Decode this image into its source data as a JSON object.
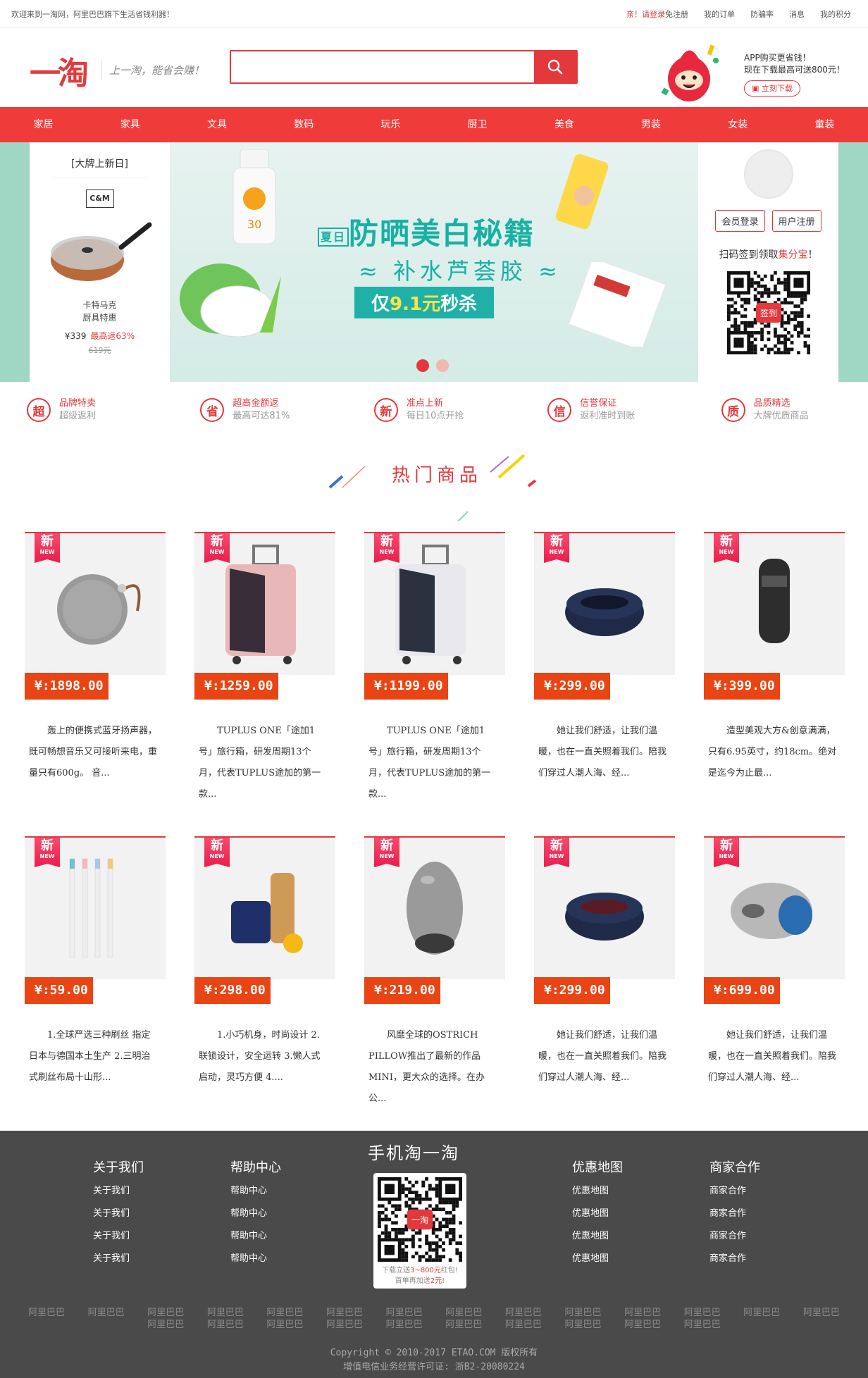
{
  "topbar": {
    "welcome": "欢迎来到一淘网，阿里巴巴旗下生活省钱利器！",
    "login_prefix": "亲！请登录",
    "register": "免注册",
    "links": [
      "我的订单",
      "防骗率",
      "消息",
      "我的积分"
    ]
  },
  "header": {
    "logo": "一淘",
    "slogan": "上一淘，能省会赚！",
    "search_placeholder": "",
    "app_promo_line1": "APP购买更省钱！",
    "app_promo_line2": "现在下载最高可送800元！",
    "download": "立刻下载"
  },
  "nav": [
    "家居",
    "家具",
    "文具",
    "数码",
    "玩乐",
    "厨卫",
    "美食",
    "男装",
    "女装",
    "童装"
  ],
  "left_card": {
    "title": "[大牌上新日]",
    "brand_logo": "C&M",
    "name_line1": "卡特马克",
    "name_line2": "厨具特惠",
    "price": "¥339",
    "rebate": "最高返63%",
    "orig_price": "619元"
  },
  "banner": {
    "headline": "防晒美白秘籍",
    "tag": "夏日",
    "subline": "补水芦荟胶",
    "promo_prefix": "仅",
    "promo_value": "9.1元",
    "promo_suffix": "秒杀",
    "sunscreen_label": "30"
  },
  "right_card": {
    "login_btn": "会员登录",
    "register_btn": "用户注册",
    "scan_text": "扫码签到领取",
    "scan_highlight": "集分宝",
    "scan_suffix": "！",
    "qr_badge": "签到"
  },
  "features": [
    {
      "icon": "超",
      "title": "品牌特卖",
      "sub": "超级返利"
    },
    {
      "icon": "省",
      "title": "超高金额返",
      "sub": "最高可达81%"
    },
    {
      "icon": "新",
      "title": "准点上新",
      "sub": "每日10点开抢"
    },
    {
      "icon": "信",
      "title": "信誉保证",
      "sub": "返利准时到账"
    },
    {
      "icon": "质",
      "title": "品质精选",
      "sub": "大牌优质商品"
    }
  ],
  "section_title": "热门商品",
  "badge": {
    "main": "新",
    "small": "NEW"
  },
  "products": [
    {
      "price": "¥:1898.00",
      "desc": "　　轰上的便携式蓝牙扬声器，既可畅想音乐又可接听来电，重量只有600g。 音...",
      "icon": "speaker"
    },
    {
      "price": "¥:1259.00",
      "desc": "　　TUPLUS ONE「途加1号」旅行箱，研发周期13个月，代表TUPLUS途加的第一款...",
      "icon": "suitcase-pink"
    },
    {
      "price": "¥:1199.00",
      "desc": "　　TUPLUS ONE「途加1号」旅行箱，研发周期13个月，代表TUPLUS途加的第一款...",
      "icon": "suitcase-white"
    },
    {
      "price": "¥:299.00",
      "desc": "　　她让我们舒适，让我们温暖，也在一直关照着我们。陪我们穿过人潮人海、经...",
      "icon": "neck-pillow"
    },
    {
      "price": "¥:399.00",
      "desc": "　　造型美观大方&创意满满，只有6.95英寸，约18cm。绝对是迄今为止最...",
      "icon": "coffee-maker"
    },
    {
      "price": "¥:59.00",
      "desc": "　　1.全球严选三种刷丝 指定日本与德国本土生产 2.三明治式刷丝布局十山形...",
      "icon": "toothbrushes"
    },
    {
      "price": "¥:298.00",
      "desc": "　　1.小巧机身，时尚设计 2.联锁设计，安全运转 3.懒人式启动，灵巧方便 4....",
      "icon": "juicer"
    },
    {
      "price": "¥:219.00",
      "desc": "　　风靡全球的OSTRICH PILLOW推出了最新的作品MINI，更大众的选择。在办公...",
      "icon": "ostrich-pillow"
    },
    {
      "price": "¥:299.00",
      "desc": "　　她让我们舒适，让我们温暖，也在一直关照着我们。陪我们穿过人潮人海、经...",
      "icon": "neck-pillow"
    },
    {
      "price": "¥:699.00",
      "desc": "　　她让我们舒适，让我们温暖，也在一直关照着我们。陪我们穿过人潮人海、经...",
      "icon": "ostrich-pillow-blue"
    }
  ],
  "footer": {
    "columns": [
      {
        "title": "关于我们",
        "items": [
          "关于我们",
          "关于我们",
          "关于我们",
          "关于我们"
        ]
      },
      {
        "title": "帮助中心",
        "items": [
          "帮助中心",
          "帮助中心",
          "帮助中心",
          "帮助中心"
        ]
      },
      {
        "title": "优惠地图",
        "items": [
          "优惠地图",
          "优惠地图",
          "优惠地图",
          "优惠地图"
        ]
      },
      {
        "title": "商家合作",
        "items": [
          "商家合作",
          "商家合作",
          "商家合作",
          "商家合作"
        ]
      }
    ],
    "app_title": "手机淘一淘",
    "qr_logo": "一淘",
    "qr_caption1_a": "下载立送",
    "qr_caption1_b": "3~800元",
    "qr_caption1_c": "红包!",
    "qr_caption2_a": "首单再加送",
    "qr_caption2_b": "2元",
    "qr_caption2_c": "!",
    "partners": [
      "阿里巴巴",
      "阿里巴巴",
      "阿里巴巴\n阿里巴巴",
      "阿里巴巴\n阿里巴巴",
      "阿里巴巴\n阿里巴巴",
      "阿里巴巴\n阿里巴巴",
      "阿里巴巴\n阿里巴巴",
      "阿里巴巴\n阿里巴巴",
      "阿里巴巴\n阿里巴巴",
      "阿里巴巴\n阿里巴巴",
      "阿里巴巴\n阿里巴巴",
      "阿里巴巴\n阿里巴巴",
      "阿里巴巴",
      "阿里巴巴"
    ],
    "copyright": "Copyright © 2010-2017 ETAO.COM 版权所有",
    "license": "增值电信业务经营许可证: 浙B2-20080224"
  },
  "colors": {
    "brand": "#e4393c",
    "nav": "#f03b3b",
    "price_tag": "#e94514",
    "banner_side": "#9fd6c4",
    "footer": "#4a4a4a",
    "teal": "#18b0a4"
  }
}
